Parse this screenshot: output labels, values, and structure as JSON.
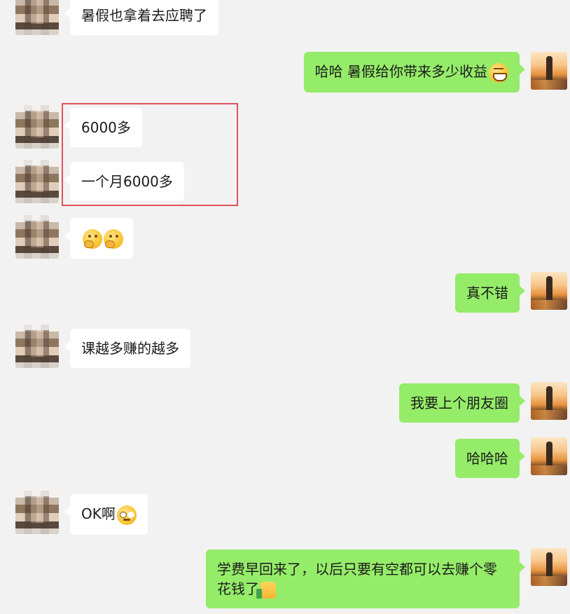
{
  "messages": [
    {
      "side": "left",
      "text": "暑假也拿着去应聘了"
    },
    {
      "side": "right",
      "text": "哈哈 暑假给你带来多少收益",
      "emoji": "grin-emoji"
    },
    {
      "side": "left",
      "text": "6000多"
    },
    {
      "side": "left",
      "text": "一个月6000多"
    },
    {
      "side": "left",
      "text": "",
      "emoji": "thinking-emoji"
    },
    {
      "side": "right",
      "text": "真不错"
    },
    {
      "side": "left",
      "text": "课越多赚的越多"
    },
    {
      "side": "right",
      "text": "我要上个朋友圈"
    },
    {
      "side": "right",
      "text": "哈哈哈"
    },
    {
      "side": "left",
      "text": "OK啊",
      "emoji": "cool-emoji"
    },
    {
      "side": "right",
      "text": "学费早回来了，以后只要有空都可以去赚个零花钱了",
      "emoji": "thumbs-up-emoji"
    }
  ],
  "highlight": {
    "color": "#e0535b"
  },
  "colors": {
    "background": "#f2f2f2",
    "sent_bubble": "#95ec69",
    "received_bubble": "#ffffff"
  }
}
